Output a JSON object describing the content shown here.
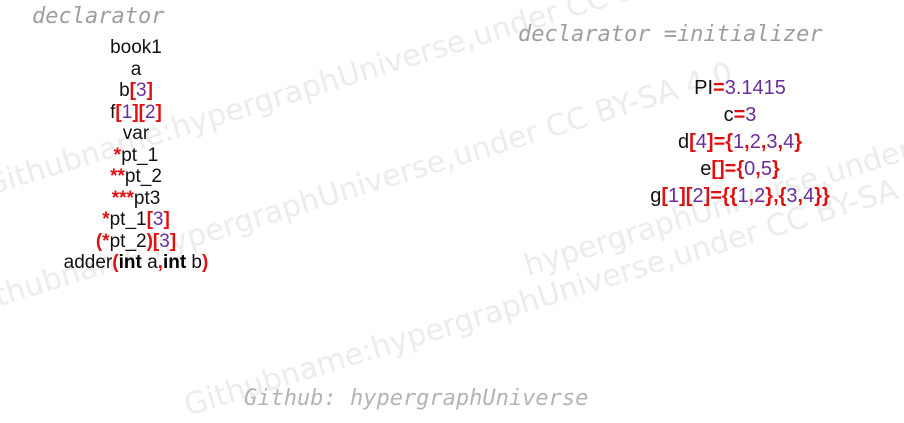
{
  "colors": {
    "red": "#e01010",
    "purple": "#6a2b9c",
    "heading": "#9e9e9e",
    "watermark": "#ececec"
  },
  "left": {
    "heading": "declarator",
    "lines": [
      [
        {
          "t": "book1",
          "c": "n"
        }
      ],
      [
        {
          "t": "a",
          "c": "n"
        }
      ],
      [
        {
          "t": "b",
          "c": "n"
        },
        {
          "t": "[",
          "c": "r"
        },
        {
          "t": "3",
          "c": "p"
        },
        {
          "t": "]",
          "c": "r"
        }
      ],
      [
        {
          "t": "f",
          "c": "n"
        },
        {
          "t": "[",
          "c": "r"
        },
        {
          "t": "1",
          "c": "p"
        },
        {
          "t": "][",
          "c": "r"
        },
        {
          "t": "2",
          "c": "p"
        },
        {
          "t": "]",
          "c": "r"
        }
      ],
      [
        {
          "t": "var",
          "c": "n"
        }
      ],
      [
        {
          "t": "*",
          "c": "r"
        },
        {
          "t": "pt_1",
          "c": "n"
        }
      ],
      [
        {
          "t": "**",
          "c": "r"
        },
        {
          "t": "pt_2",
          "c": "n"
        }
      ],
      [
        {
          "t": "***",
          "c": "r"
        },
        {
          "t": "pt3",
          "c": "n"
        }
      ],
      [
        {
          "t": "*",
          "c": "r"
        },
        {
          "t": "pt_1",
          "c": "n"
        },
        {
          "t": "[",
          "c": "r"
        },
        {
          "t": "3",
          "c": "p"
        },
        {
          "t": "]",
          "c": "r"
        }
      ],
      [
        {
          "t": "(*",
          "c": "r"
        },
        {
          "t": "pt_2",
          "c": "n"
        },
        {
          "t": ")",
          "c": "r"
        },
        {
          "t": "[",
          "c": "r"
        },
        {
          "t": "3",
          "c": "p"
        },
        {
          "t": "]",
          "c": "r"
        }
      ],
      [
        {
          "t": "adder",
          "c": "n"
        },
        {
          "t": "(",
          "c": "r"
        },
        {
          "t": "int",
          "c": "k"
        },
        {
          "t": " a",
          "c": "n"
        },
        {
          "t": ",",
          "c": "r"
        },
        {
          "t": "int",
          "c": "k"
        },
        {
          "t": " b",
          "c": "n"
        },
        {
          "t": ")",
          "c": "r"
        }
      ]
    ]
  },
  "right": {
    "heading": "declarator =initializer",
    "lines": [
      [
        {
          "t": "PI",
          "c": "n"
        },
        {
          "t": "=",
          "c": "r"
        },
        {
          "t": "3.1415",
          "c": "p"
        }
      ],
      [
        {
          "t": "c",
          "c": "n"
        },
        {
          "t": "=",
          "c": "r"
        },
        {
          "t": "3",
          "c": "p"
        }
      ],
      [
        {
          "t": "d",
          "c": "n"
        },
        {
          "t": "[",
          "c": "r"
        },
        {
          "t": "4",
          "c": "p"
        },
        {
          "t": "]={",
          "c": "r"
        },
        {
          "t": "1",
          "c": "p"
        },
        {
          "t": ",",
          "c": "r"
        },
        {
          "t": "2",
          "c": "p"
        },
        {
          "t": ",",
          "c": "r"
        },
        {
          "t": "3",
          "c": "p"
        },
        {
          "t": ",",
          "c": "r"
        },
        {
          "t": "4",
          "c": "p"
        },
        {
          "t": "}",
          "c": "r"
        }
      ],
      [
        {
          "t": "e",
          "c": "n"
        },
        {
          "t": "[]={",
          "c": "r"
        },
        {
          "t": "0",
          "c": "p"
        },
        {
          "t": ",",
          "c": "r"
        },
        {
          "t": "5",
          "c": "p"
        },
        {
          "t": "}",
          "c": "r"
        }
      ],
      [
        {
          "t": "g",
          "c": "n"
        },
        {
          "t": "[",
          "c": "r"
        },
        {
          "t": "1",
          "c": "p"
        },
        {
          "t": "][",
          "c": "r"
        },
        {
          "t": "2",
          "c": "p"
        },
        {
          "t": "]={{",
          "c": "r"
        },
        {
          "t": "1",
          "c": "p"
        },
        {
          "t": ",",
          "c": "r"
        },
        {
          "t": "2",
          "c": "p"
        },
        {
          "t": "},{",
          "c": "r"
        },
        {
          "t": "3",
          "c": "p"
        },
        {
          "t": ",",
          "c": "r"
        },
        {
          "t": "4",
          "c": "p"
        },
        {
          "t": "}}",
          "c": "r"
        }
      ]
    ]
  },
  "footer": "Github: hypergraphUniverse",
  "watermarks": [
    "Githubname:hypergraphUniverse,under CC BY-SA 4.0",
    "Githubname:hypergraphUniverse,under CC BY-SA 4.0",
    "Githubname:hypergraphUniverse,under CC BY-SA 4.0",
    "hypergraphUniverse,under CC"
  ]
}
